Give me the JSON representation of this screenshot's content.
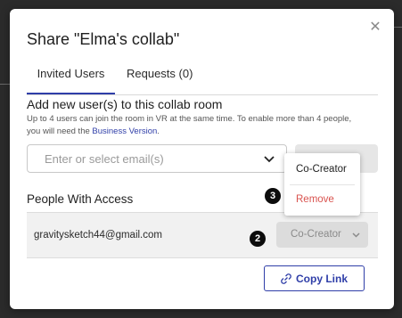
{
  "dialog": {
    "title": "Share \"Elma's collab\"",
    "close_icon": "close-icon"
  },
  "tabs": [
    {
      "label": "Invited Users",
      "active": true
    },
    {
      "label": "Requests (0)",
      "active": false
    }
  ],
  "add_users": {
    "heading": "Add new user(s) to this collab room",
    "description": "Up to 4 users can join the room in VR at the same time. To enable more than 4 people, you will need the ",
    "link_text": "Business Version",
    "description_end": ".",
    "email_placeholder": "Enter or select email(s)"
  },
  "people": {
    "heading": "People With Access",
    "rows": [
      {
        "email": "gravitysketch44@gmail.com",
        "role": "Co-Creator"
      }
    ]
  },
  "role_menu": {
    "options": [
      "Co-Creator",
      "Remove"
    ]
  },
  "annotations": {
    "badge_2": "2",
    "badge_3": "3"
  },
  "copy_link": {
    "label": "Copy Link",
    "icon": "link-icon"
  },
  "colors": {
    "accent": "#2f3ea8",
    "danger": "#d9534f",
    "backdrop": "#2b2b2b"
  }
}
